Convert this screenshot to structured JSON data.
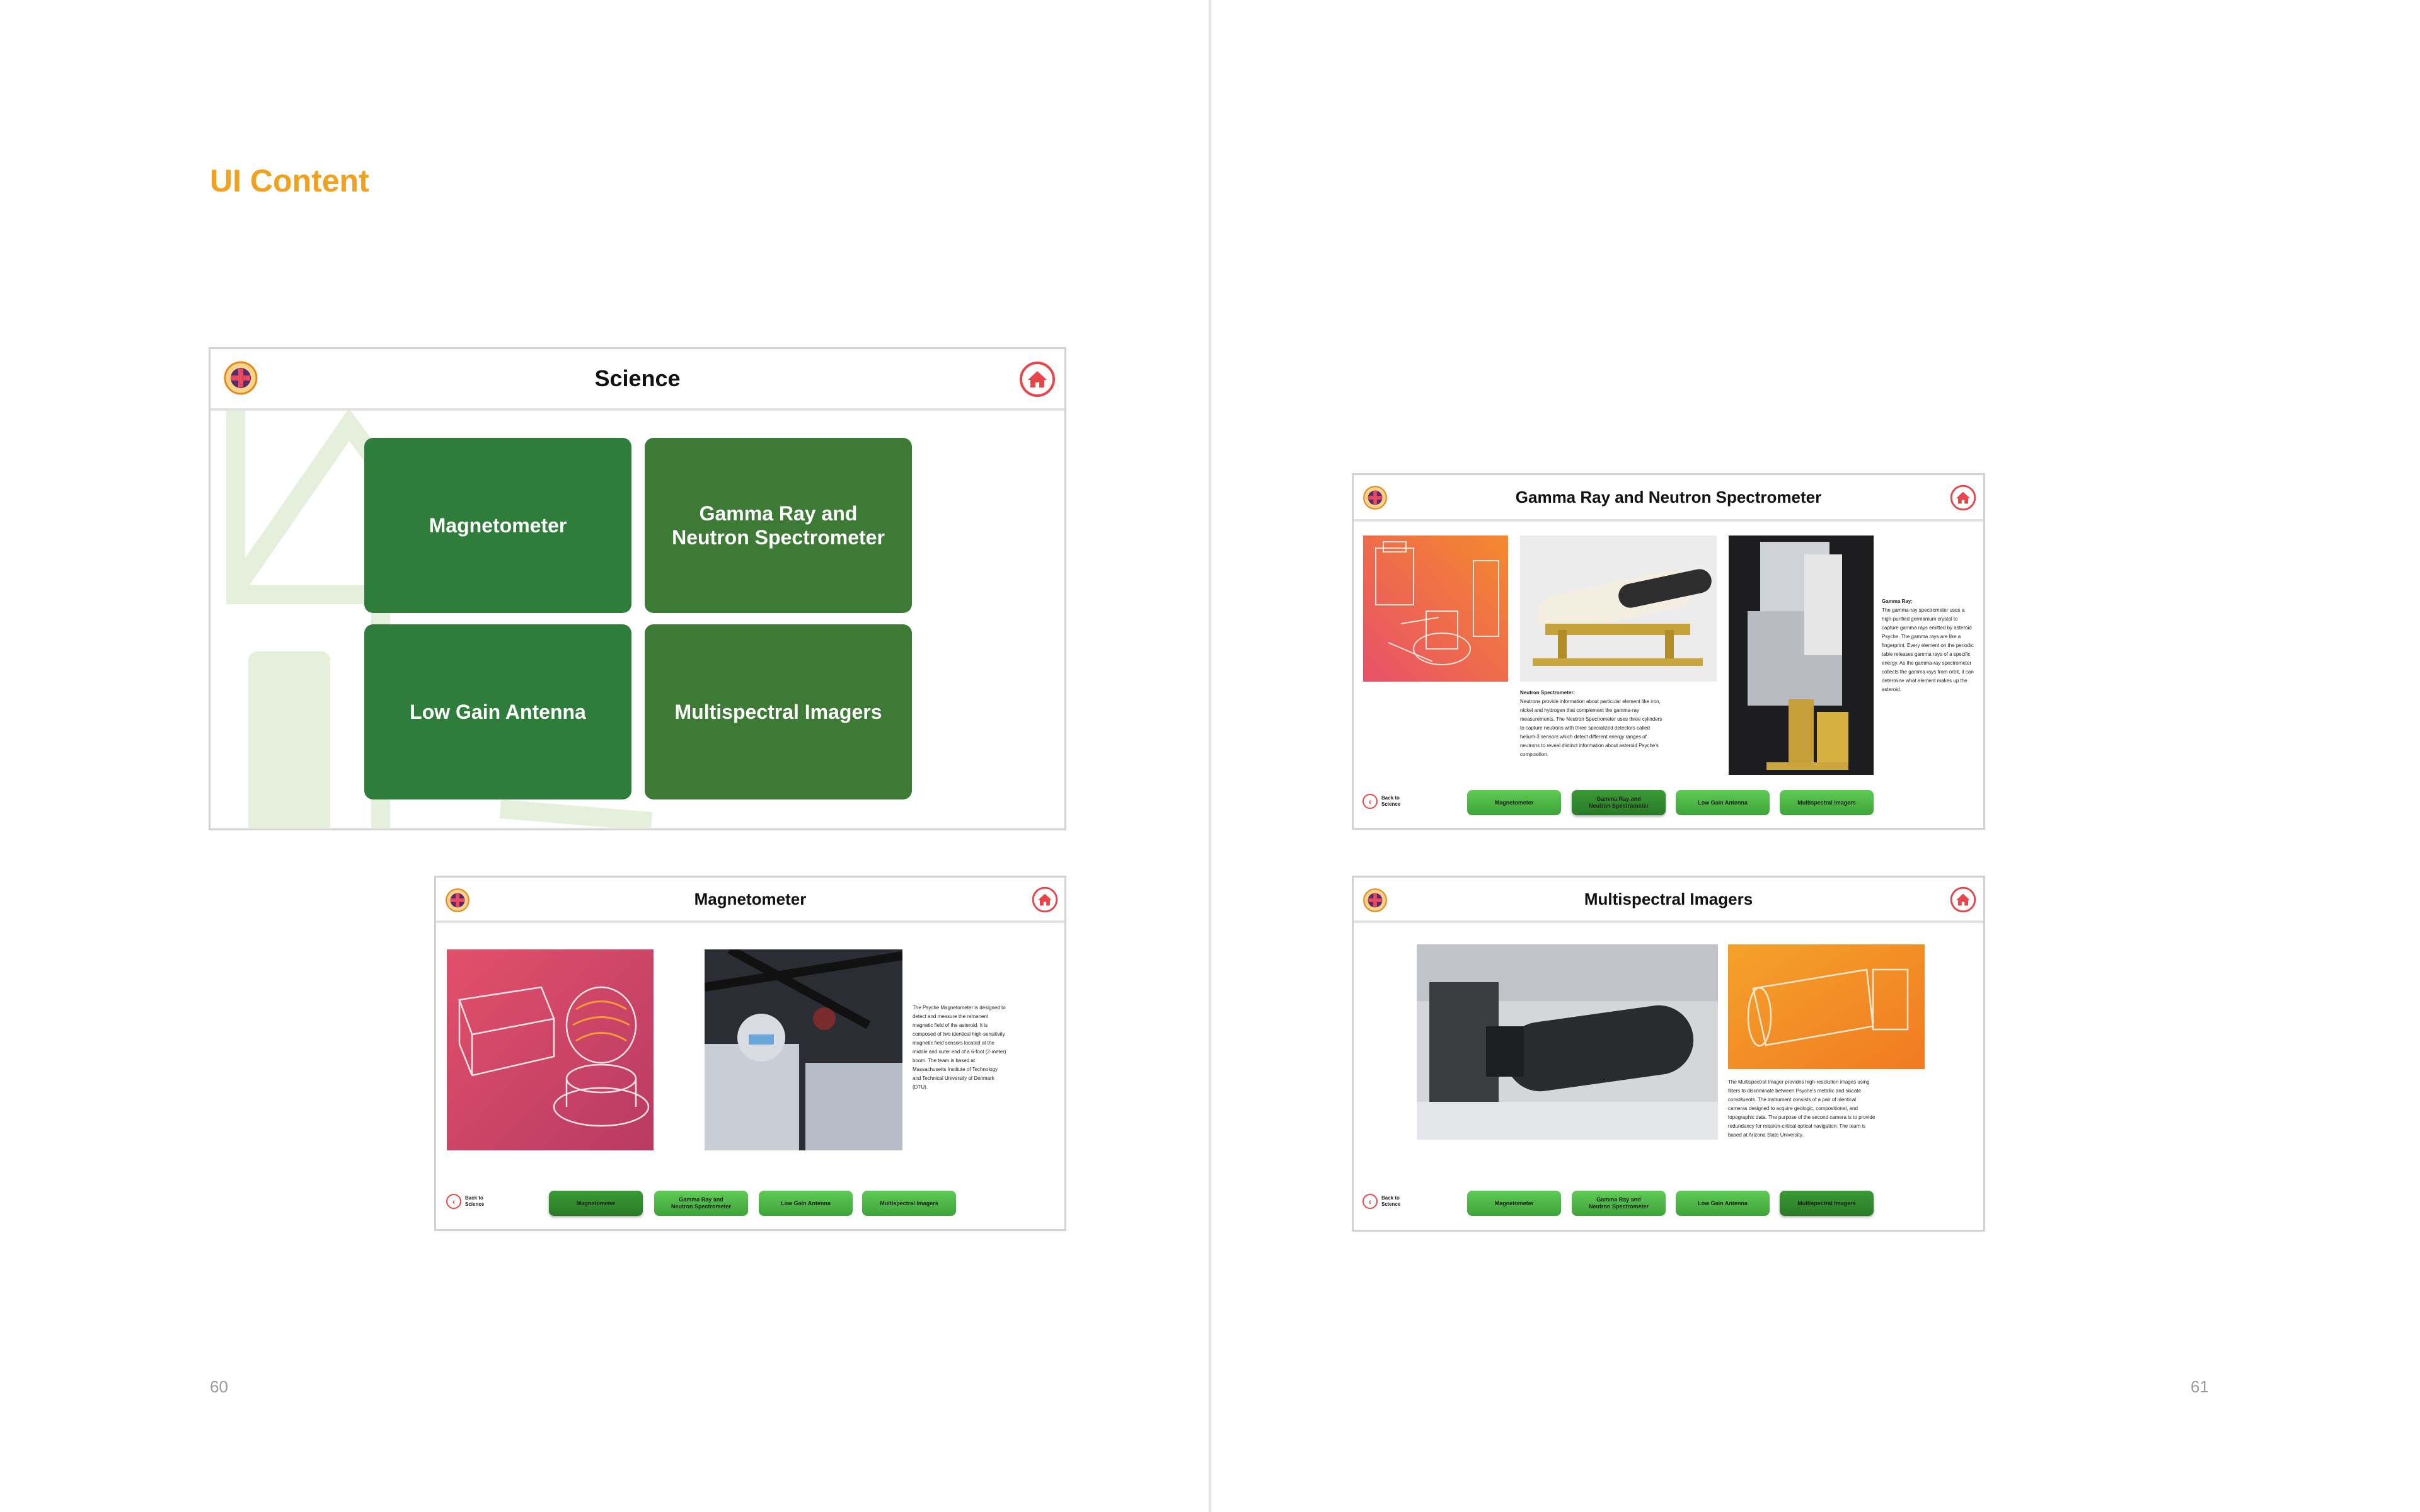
{
  "document": {
    "heading": "UI Content",
    "page_left": "60",
    "page_right": "61"
  },
  "science_screen": {
    "title": "Science",
    "tiles": [
      "Magnetometer",
      "Gamma Ray and\nNeutron Spectrometer",
      "Low Gain Antenna",
      "Multispectral Imagers"
    ]
  },
  "magnetometer_screen": {
    "title": "Magnetometer",
    "body": "The Psyche Magnetometer is designed to detect and measure the remanent magnetic field of the asteroid. It is composed of two identical high-sensitivity magnetic field sensors located at the middle and outer end of a 6-foot (2-meter) boom. The team is based at Massachusetts Institute of Technology and Technical University of Denmark (DTU)."
  },
  "grns_screen": {
    "title": "Gamma Ray and Neutron Spectrometer",
    "neutron_heading": "Neutron Spectrometer:",
    "neutron_body": "Neutrons provide information about particular element like iron, nickel and hydrogen that complement the gamma-ray measurements. The Neutron Spectrometer uses three cylinders to capture neutrons with three specialized detectors called helium-3 sensors which detect different energy ranges of neutrons to reveal distinct information about asteroid Psyche's composition.",
    "gamma_heading": "Gamma Ray:",
    "gamma_body": "The gamma-ray spectrometer uses a high-purified germanium crystal to capture gamma rays emitted by asteroid Psyche. The gamma rays are like a fingerprint. Every element on the periodic table releases gamma rays of a specific energy. As the gamma-ray spectrometer collects the gamma rays from orbit, it can determine what element makes up the asteroid."
  },
  "msi_screen": {
    "title": "Multispectral Imagers",
    "body": "The Multispectral Imager provides high-resolution images using filters to discriminate between Psyche's metallic and silicate constituents. The instrument consists of a pair of identical cameras designed to acquire geologic, compositional, and topographic data. The purpose of the second camera is to provide redundancy for mission-critical optical navigation. The team is based at Arizona State University."
  },
  "nav": {
    "back_label": "Back to\nScience",
    "buttons": [
      "Magnetometer",
      "Gamma Ray and\nNeutron Spectrometer",
      "Low Gain Antenna",
      "Multispectral Imagers"
    ]
  },
  "colors": {
    "heading": "#f2a11f",
    "tile_green": "#2e7d3a",
    "tile_green_alt": "#3d7a35",
    "pill_green": "#4cb748",
    "home_red": "#e8454a"
  }
}
